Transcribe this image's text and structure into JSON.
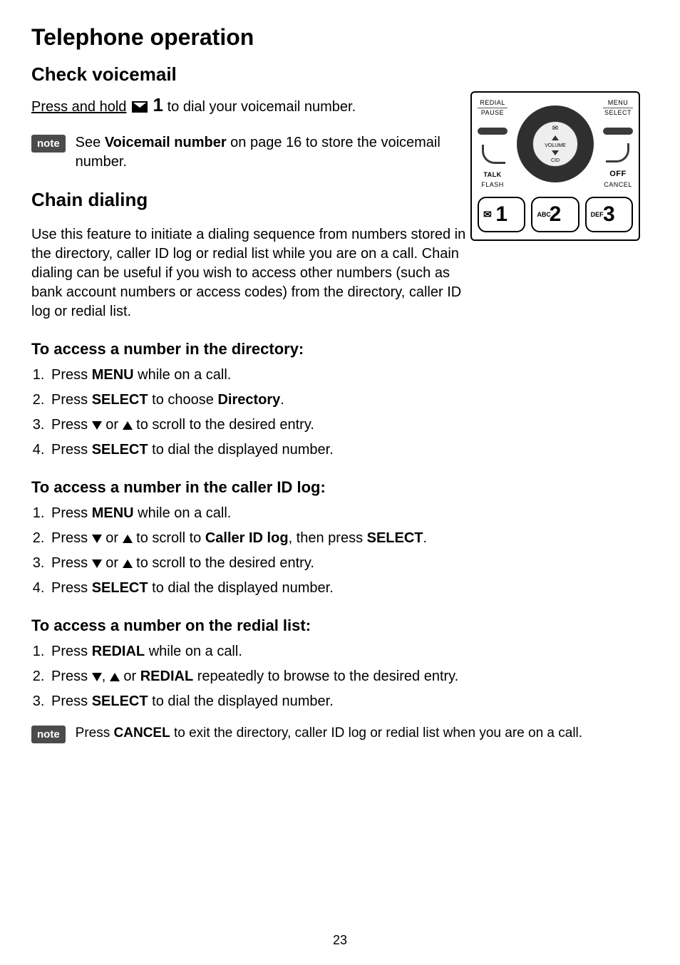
{
  "page_number": "23",
  "title": "Telephone operation",
  "voicemail": {
    "heading": "Check voicemail",
    "press_hold": "Press and hold",
    "key_digit": "1",
    "to_dial": " to dial your voicemail number.",
    "note_badge": "note",
    "note_pre": "See ",
    "note_bold": "Voicemail number",
    "note_post": " on page 16 to store the voicemail number."
  },
  "chain": {
    "heading": "Chain dialing",
    "body": "Use this feature to initiate a dialing sequence from numbers stored in the directory, caller ID log or redial list while you are on a call. Chain dialing can be useful if you wish to access other numbers (such as bank account numbers or access codes) from the directory, caller ID log or redial list."
  },
  "sec1": {
    "heading": "To access a number in the directory:",
    "s1a": "Press ",
    "s1b": "MENU",
    "s1c": " while on a call.",
    "s2a": "Press ",
    "s2b": "SELECT",
    "s2c": " to choose ",
    "s2d": "Directory",
    "s2e": ".",
    "s3a": "Press ",
    "s3b": " or ",
    "s3c": " to scroll to the desired entry.",
    "s4a": "Press ",
    "s4b": "SELECT",
    "s4c": " to dial the displayed number."
  },
  "sec2": {
    "heading": "To access a number in the caller ID log:",
    "s1a": "Press ",
    "s1b": "MENU",
    "s1c": " while on a call.",
    "s2a": "Press ",
    "s2b": " or ",
    "s2c": " to scroll to ",
    "s2d": "Caller ID log",
    "s2e": ", then press ",
    "s2f": "SELECT",
    "s2g": ".",
    "s3a": "Press ",
    "s3b": " or ",
    "s3c": " to scroll to the desired entry.",
    "s4a": "Press ",
    "s4b": "SELECT",
    "s4c": " to dial the displayed number."
  },
  "sec3": {
    "heading": "To access a number on the redial list:",
    "s1a": "Press ",
    "s1b": "REDIAL",
    "s1c": " while on a call.",
    "s2a": "Press ",
    "s2b": ", ",
    "s2c": " or ",
    "s2d": "REDIAL",
    "s2e": " repeatedly to browse to the desired entry.",
    "s3a": "Press ",
    "s3b": "SELECT",
    "s3c": " to dial the displayed number."
  },
  "footnote": {
    "badge": "note",
    "pre": "Press ",
    "bold": "CANCEL",
    "post": " to exit the directory, caller ID log or redial list when you are on a call."
  },
  "phone": {
    "redial": "REDIAL",
    "pause": "PAUSE",
    "menu": "MENU",
    "select": "SELECT",
    "talk": "TALK",
    "flash": "FLASH",
    "off": "OFF",
    "cancel": "CANCEL",
    "volume": "VOLUME",
    "cid": "CID",
    "key1": "1",
    "key2_small": "ABC",
    "key2": "2",
    "key3_small": "DEF",
    "key3": "3"
  }
}
